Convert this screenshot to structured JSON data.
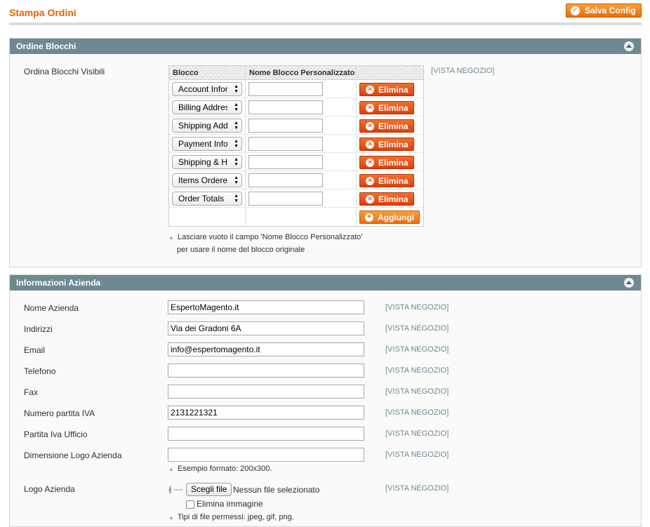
{
  "page": {
    "title": "Stampa Ordini",
    "save_label": "Salva Config"
  },
  "colors": {
    "title": "#eb5e00",
    "section_header": "#6f8992",
    "delete_button": "#dd3f0c",
    "primary_button": "#e96d0e",
    "scope_text": "#6f8992"
  },
  "blocks_section": {
    "title": "Ordine Blocchi",
    "field_label": "Ordina Blocchi Visibili",
    "scope": "[VISTA NEGOZIO]",
    "columns": [
      "Blocco",
      "Nome Blocco Personalizzato"
    ],
    "rows": [
      {
        "block": "Account Information",
        "custom_name": "",
        "delete_label": "Elimina"
      },
      {
        "block": "Billing Address",
        "custom_name": "",
        "delete_label": "Elimina"
      },
      {
        "block": "Shipping Address",
        "custom_name": "",
        "delete_label": "Elimina"
      },
      {
        "block": "Payment Information",
        "custom_name": "",
        "delete_label": "Elimina"
      },
      {
        "block": "Shipping & Handling",
        "custom_name": "",
        "delete_label": "Elimina"
      },
      {
        "block": "Items Ordered",
        "custom_name": "",
        "delete_label": "Elimina"
      },
      {
        "block": "Order Totals",
        "custom_name": "",
        "delete_label": "Elimina"
      }
    ],
    "add_label": "Aggiungi",
    "note_line1": "Lasciare vuoto il campo 'Nome Blocco Personalizzato'",
    "note_line2": "per usare il nome del blocco originale"
  },
  "company_section": {
    "title": "Informazioni Azienda",
    "fields": [
      {
        "label": "Nome Azienda",
        "value": "EspertoMagento.it",
        "scope": "[VISTA NEGOZIO]"
      },
      {
        "label": "Indirizzi",
        "value": "Via dei Gradoni 6A",
        "scope": "[VISTA NEGOZIO]"
      },
      {
        "label": "Email",
        "value": "info@espertomagento.it",
        "scope": "[VISTA NEGOZIO]"
      },
      {
        "label": "Telefono",
        "value": "",
        "scope": "[VISTA NEGOZIO]"
      },
      {
        "label": "Fax",
        "value": "",
        "scope": "[VISTA NEGOZIO]"
      },
      {
        "label": "Numero partita IVA",
        "value": "2131221321",
        "scope": "[VISTA NEGOZIO]"
      },
      {
        "label": "Partita Iva Ufficio",
        "value": "",
        "scope": "[VISTA NEGOZIO]"
      },
      {
        "label": "Dimensione Logo Azienda",
        "value": "",
        "scope": "[VISTA NEGOZIO]"
      }
    ],
    "logo_size_note": "Esempio formato: 200x300.",
    "logo": {
      "label": "Logo Azienda",
      "choose_label": "Scegli file",
      "no_file_label": "Nessun file selezionato",
      "delete_image_label": "Elimina immagine",
      "allowed_note": "Tipi di file permessi: jpeg, gif, png.",
      "scope": "[VISTA NEGOZIO]"
    }
  }
}
